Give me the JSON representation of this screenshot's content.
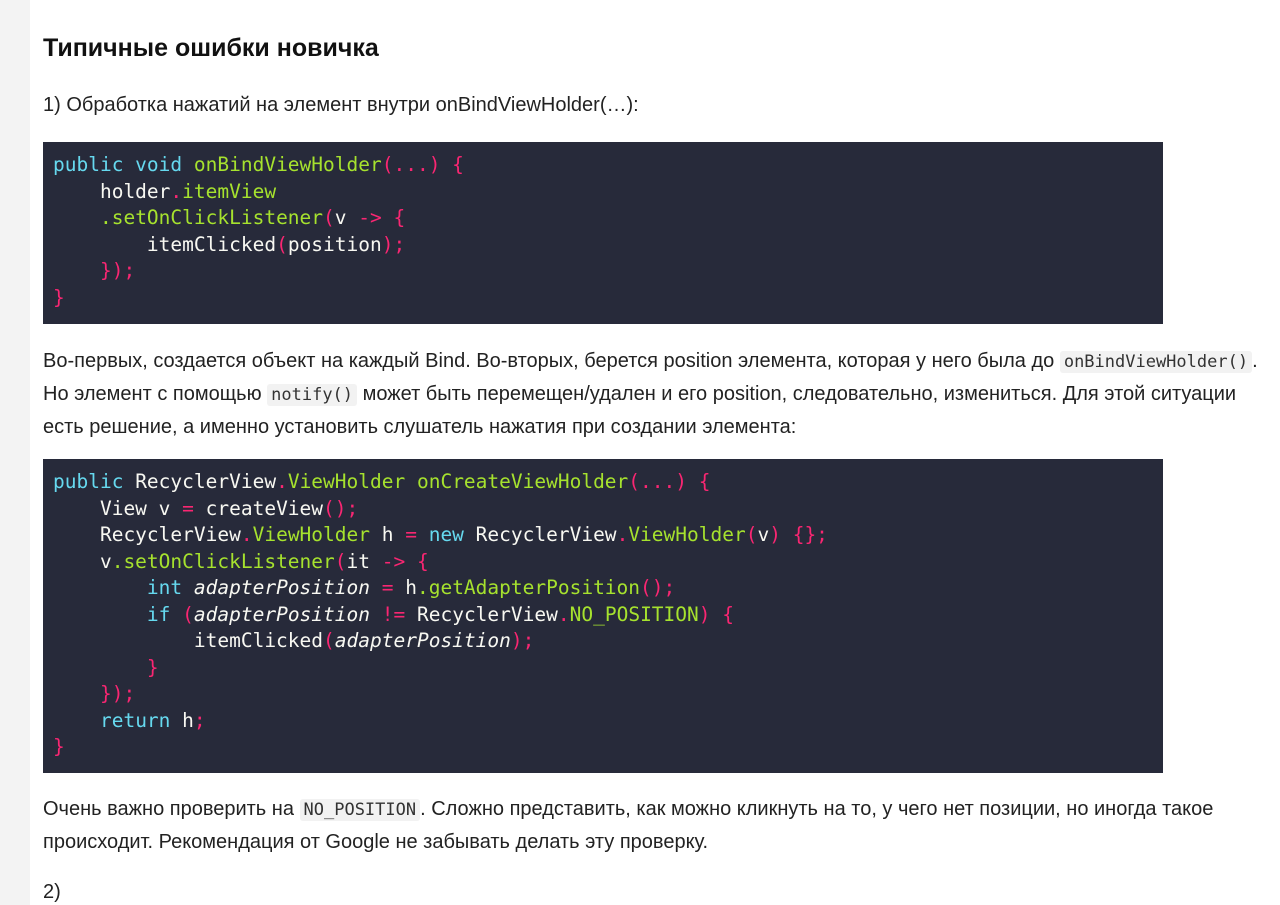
{
  "heading": "Типичные ошибки новичка",
  "item1": "1) Обработка нажатий на элемент внутри onBindViewHolder(…):",
  "code1": {
    "l1": {
      "a": "public void ",
      "b": "onBindViewHolder",
      "c": "(...) {"
    },
    "l2": {
      "a": "    holder",
      "b": ".",
      "c": "itemView"
    },
    "l3": {
      "a": "    ",
      "b": ".setOnClickListener",
      "c": "(",
      "d": "v ",
      "e": "-> {"
    },
    "l4": {
      "a": "        itemClicked",
      "b": "(",
      "c": "position",
      "d": ");"
    },
    "l5": {
      "a": "    });"
    },
    "l6": {
      "a": "}"
    }
  },
  "para1": {
    "t1": "Во-первых, создается объект на каждый Bind. Во-вторых, берется position элемента, которая у него была до ",
    "c1": "onBindViewHolder()",
    "t2": ". Но элемент с помощью ",
    "c2": "notify()",
    "t3": " может быть перемещен/удален и его position, следовательно, измениться. Для этой ситуации есть решение, а именно установить слушатель нажатия при создании элемента:"
  },
  "code2": {
    "l1": {
      "a": "public ",
      "b": "RecyclerView",
      "c": ".",
      "d": "ViewHolder ",
      "e": "onCreateViewHolder",
      "f": "(...) {"
    },
    "l2": {
      "a": "    View v ",
      "b": "= ",
      "c": "createView",
      "d": "();"
    },
    "l3": {
      "a": "    RecyclerView",
      "b": ".",
      "c": "ViewHolder ",
      "d": "h ",
      "e": "= ",
      "f": "new ",
      "g": "RecyclerView",
      "h": ".",
      "i": "ViewHolder",
      "j": "(",
      "k": "v",
      "l": ") {};"
    },
    "l4": {
      "a": "    v",
      "b": ".setOnClickListener",
      "c": "(",
      "d": "it ",
      "e": "-> {"
    },
    "l5": {
      "a": "        ",
      "b": "int ",
      "c": "adapterPosition ",
      "d": "= ",
      "e": "h",
      "f": ".getAdapterPosition",
      "g": "();"
    },
    "l6": {
      "a": "        ",
      "b": "if ",
      "c": "(",
      "d": "adapterPosition ",
      "e": "!= ",
      "f": "RecyclerView",
      "g": ".",
      "h": "NO_POSITION",
      "i": ") {"
    },
    "l7": {
      "a": "            itemClicked",
      "b": "(",
      "c": "adapterPosition",
      "d": ");"
    },
    "l8": {
      "a": "        }"
    },
    "l9": {
      "a": "    });"
    },
    "l10": {
      "a": "    ",
      "b": "return ",
      "c": "h",
      "d": ";"
    },
    "l11": {
      "a": "}"
    }
  },
  "para2": {
    "t1": "Очень важно проверить на ",
    "c1": "NO_POSITION",
    "t2": ". Сложно представить, как можно кликнуть на то, у чего нет позиции, но иногда такое происходит. Рекомендация от Google не забывать делать эту проверку."
  },
  "item2": "2)"
}
